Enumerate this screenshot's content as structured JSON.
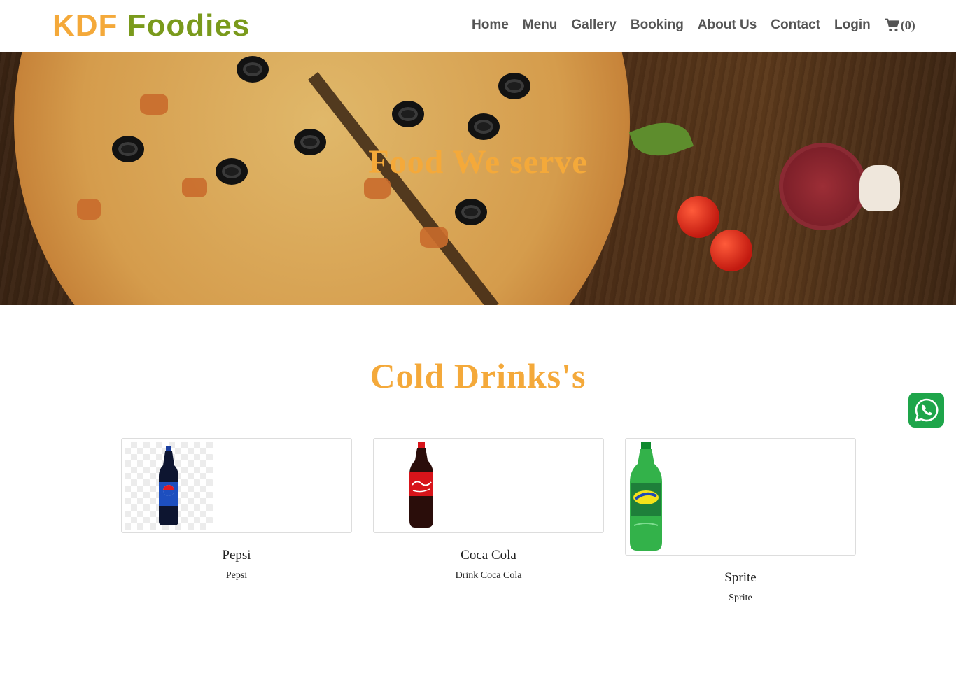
{
  "brand": {
    "part1": "KDF",
    "part2": "Foodies",
    "color1": "#f4a93a",
    "color2": "#7a9a1c"
  },
  "nav": {
    "items": [
      "Home",
      "Menu",
      "Gallery",
      "Booking",
      "About Us",
      "Contact",
      "Login"
    ],
    "cart_icon": "shopping-cart-icon",
    "cart_count": "(0)"
  },
  "hero": {
    "title": "Food We serve"
  },
  "section": {
    "title": "Cold Drinks's"
  },
  "products": [
    {
      "name": "Pepsi",
      "description": "Pepsi",
      "image": "pepsi-bottle"
    },
    {
      "name": "Coca Cola",
      "description": "Drink Coca Cola",
      "image": "coca-cola-bottle"
    },
    {
      "name": "Sprite",
      "description": "Sprite",
      "image": "sprite-bottle"
    }
  ],
  "floating": {
    "whatsapp_icon": "whatsapp-icon"
  },
  "colors": {
    "accent": "#f4a93a",
    "nav_text": "#555555",
    "whatsapp": "#1ea54a"
  }
}
